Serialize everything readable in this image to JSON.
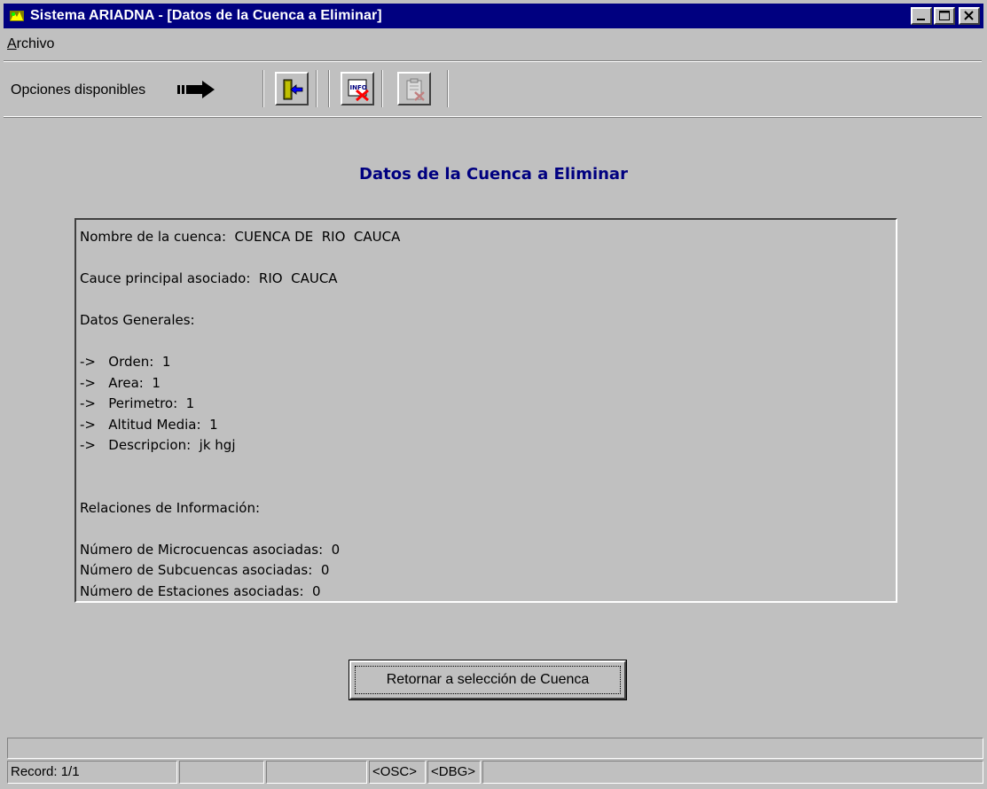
{
  "window": {
    "title": "Sistema ARIADNA - [Datos de la Cuenca a Eliminar]"
  },
  "menu": {
    "archivo_pre": "",
    "archivo_u": "A",
    "archivo_rest": "rchivo"
  },
  "toolbar": {
    "options_label": "Opciones disponibles",
    "buttons": [
      "exit-icon",
      "info-delete-icon",
      "clipboard-delete-icon"
    ]
  },
  "main": {
    "heading": "Datos de la Cuenca a Eliminar",
    "lines": [
      "Nombre de la cuenca:  CUENCA DE  RIO  CAUCA",
      "",
      "Cauce principal asociado:  RIO  CAUCA",
      "",
      "Datos Generales:",
      "",
      "->   Orden:  1",
      "->   Area:  1",
      "->   Perimetro:  1",
      "->   Altitud Media:  1",
      "->   Descripcion:  jk hgj",
      "",
      "",
      "Relaciones de Información:",
      "",
      "Número de Microcuencas asociadas:  0",
      "Número de Subcuencas asociadas:  0",
      "Número de Estaciones asociadas:  0"
    ],
    "return_button": "Retornar a selección de Cuenca"
  },
  "status": {
    "record": "Record: 1/1",
    "osc": "<OSC>",
    "dbg": "<DBG>"
  },
  "colors": {
    "title_bar": "#000080",
    "heading": "#000080",
    "face": "#c0c0c0"
  }
}
